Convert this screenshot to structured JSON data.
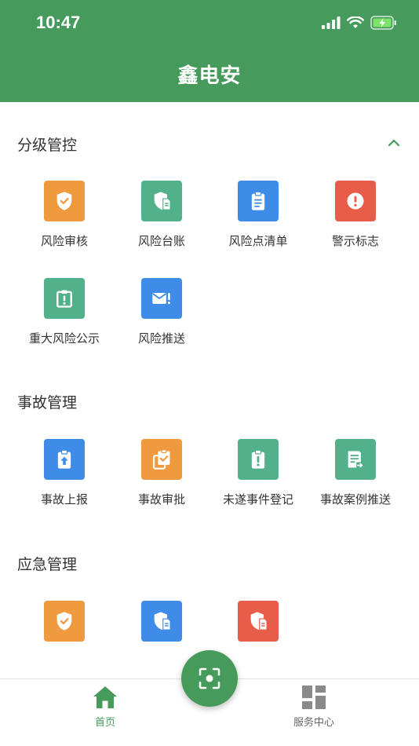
{
  "status": {
    "time": "10:47"
  },
  "app": {
    "title": "鑫电安"
  },
  "colors": {
    "primary": "#469a5c",
    "orange": "#ef9a3e",
    "teal": "#52b08b",
    "blue": "#3e8be8",
    "red": "#e85c4a"
  },
  "sections": [
    {
      "title": "分级管控",
      "items": [
        {
          "label": "风险审核",
          "icon": "shield-check-icon",
          "color": "#ef9a3e"
        },
        {
          "label": "风险台账",
          "icon": "shield-document-icon",
          "color": "#52b08b"
        },
        {
          "label": "风险点清单",
          "icon": "clipboard-list-icon",
          "color": "#3e8be8"
        },
        {
          "label": "警示标志",
          "icon": "alert-circle-icon",
          "color": "#e85c4a"
        },
        {
          "label": "重大风险公示",
          "icon": "badge-alert-icon",
          "color": "#52b08b"
        },
        {
          "label": "风险推送",
          "icon": "mail-alert-icon",
          "color": "#3e8be8"
        }
      ]
    },
    {
      "title": "事故管理",
      "items": [
        {
          "label": "事故上报",
          "icon": "clipboard-upload-icon",
          "color": "#3e8be8"
        },
        {
          "label": "事故审批",
          "icon": "clipboard-check-icon",
          "color": "#ef9a3e"
        },
        {
          "label": "未遂事件登记",
          "icon": "clipboard-alert-icon",
          "color": "#52b08b"
        },
        {
          "label": "事故案例推送",
          "icon": "document-send-icon",
          "color": "#52b08b"
        }
      ]
    },
    {
      "title": "应急管理",
      "items": [
        {
          "icon": "shield-check-icon",
          "color": "#ef9a3e"
        },
        {
          "icon": "shield-document-icon",
          "color": "#3e8be8"
        },
        {
          "icon": "shield-document-icon",
          "color": "#e85c4a"
        }
      ]
    }
  ],
  "tabbar": {
    "home": {
      "label": "首页",
      "icon": "home-icon"
    },
    "scan": {
      "icon": "scan-icon"
    },
    "services": {
      "label": "服务中心",
      "icon": "dashboard-icon"
    }
  }
}
